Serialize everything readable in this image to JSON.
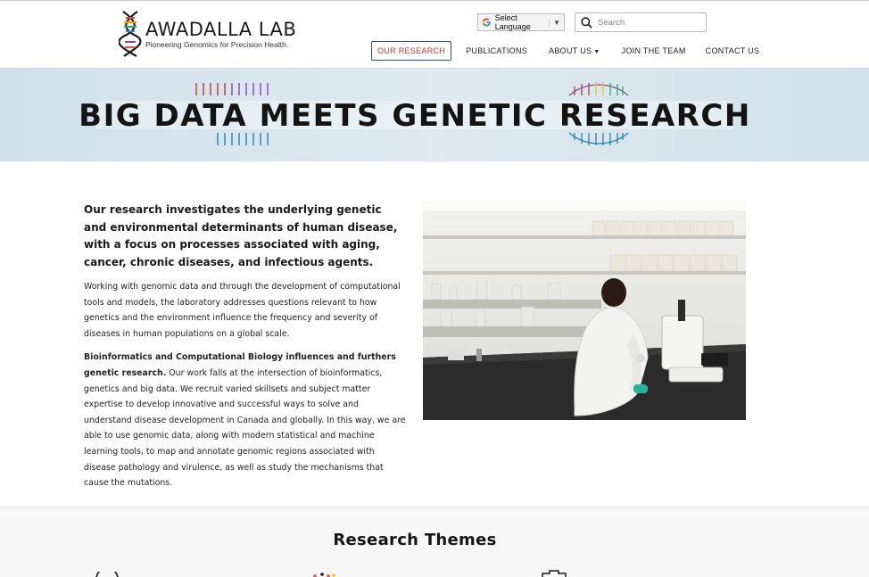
{
  "header": {
    "logo_name": "AWADALLA LAB",
    "logo_tagline": "Pioneering Genomics for Precision Health.",
    "translate_label": "Select Language",
    "search_placeholder": "Search",
    "nav": [
      {
        "label": "OUR RESEARCH"
      },
      {
        "label": "PUBLICATIONS"
      },
      {
        "label": "ABOUT US"
      },
      {
        "label": "JOIN THE TEAM"
      },
      {
        "label": "CONTACT US"
      }
    ]
  },
  "hero": {
    "title": "BIG DATA MEETS GENETIC RESEARCH"
  },
  "main": {
    "lead": "Our research investigates the underlying genetic and environmental determinants of human disease, with a focus on processes associated with aging, cancer, chronic diseases, and infectious agents.",
    "para1": "Working with genomic data and through the development of computational tools and models, the laboratory addresses questions relevant to how genetics and the environment influence the frequency and severity of diseases in human populations on a global scale.",
    "para2_bold": "Bioinformatics and Computational Biology influences and furthers genetic research.",
    "para2_rest": " Our work falls at the intersection of bioinformatics, genetics and big data. We recruit varied skillsets and subject matter expertise to develop innovative and successful ways to solve and understand disease development in Canada and globally. In this way, we are able to use genomic data, along with modern statistical and machine learning tools, to map and annotate genomic regions associated with disease pathology and virulence, as well as study the mechanisms that cause the mutations."
  },
  "themes": {
    "title": "Research Themes"
  },
  "colors": {
    "nav_active_border": "#2b4e86",
    "nav_active_text": "#c0392b",
    "hero_bg": "#d8e6ee"
  },
  "icons": [
    "dna-logo-icon",
    "google-icon",
    "search-icon",
    "dropdown-caret-icon"
  ]
}
